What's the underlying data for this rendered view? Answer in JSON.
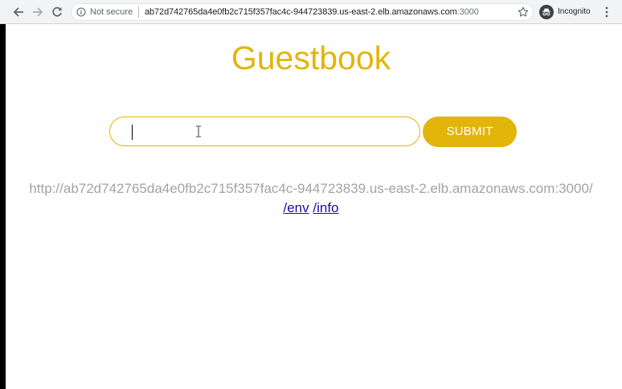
{
  "browser": {
    "security_label": "Not secure",
    "url_host": "ab72d742765da4e0fb2c715f357fac4c-944723839.us-east-2.elb.amazonaws.com",
    "url_port": ":3000",
    "profile_label": "Incognito",
    "icons": [
      "back-icon",
      "forward-icon",
      "reload-icon",
      "info-icon",
      "star-icon",
      "incognito-icon",
      "menu-icon"
    ]
  },
  "page": {
    "title": "Guestbook",
    "input_value": "",
    "submit_label": "SUBMIT",
    "host_url": "http://ab72d742765da4e0fb2c715f357fac4c-944723839.us-east-2.elb.amazonaws.com:3000/",
    "links": {
      "env": "/env",
      "info": "/info"
    }
  },
  "colors": {
    "accent": "#e2b50b",
    "host_text": "#a3a3a3",
    "link": "#1a0dab"
  }
}
